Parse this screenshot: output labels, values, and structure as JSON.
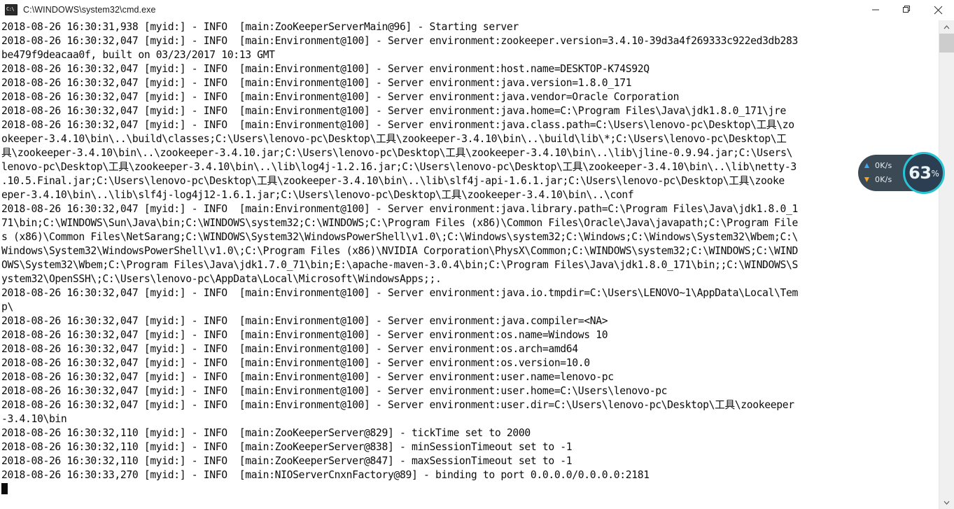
{
  "window": {
    "title": "C:\\WINDOWS\\system32\\cmd.exe",
    "icon": "cmd-icon",
    "controls": {
      "minimize": "Minimize",
      "maximize": "Maximize",
      "close": "Close"
    }
  },
  "console": {
    "prompt_cursor": "█",
    "lines": [
      "2018-08-26 16:30:31,938 [myid:] - INFO  [main:ZooKeeperServerMain@96] - Starting server",
      "2018-08-26 16:30:32,047 [myid:] - INFO  [main:Environment@100] - Server environment:zookeeper.version=3.4.10-39d3a4f269333c922ed3db283",
      "be479f9deacaa0f, built on 03/23/2017 10:13 GMT",
      "2018-08-26 16:30:32,047 [myid:] - INFO  [main:Environment@100] - Server environment:host.name=DESKTOP-K74S92Q",
      "2018-08-26 16:30:32,047 [myid:] - INFO  [main:Environment@100] - Server environment:java.version=1.8.0_171",
      "2018-08-26 16:30:32,047 [myid:] - INFO  [main:Environment@100] - Server environment:java.vendor=Oracle Corporation",
      "2018-08-26 16:30:32,047 [myid:] - INFO  [main:Environment@100] - Server environment:java.home=C:\\Program Files\\Java\\jdk1.8.0_171\\jre",
      "2018-08-26 16:30:32,047 [myid:] - INFO  [main:Environment@100] - Server environment:java.class.path=C:\\Users\\lenovo-pc\\Desktop\\工具\\zo",
      "okeeper-3.4.10\\bin\\..\\build\\classes;C:\\Users\\lenovo-pc\\Desktop\\工具\\zookeeper-3.4.10\\bin\\..\\build\\lib\\*;C:\\Users\\lenovo-pc\\Desktop\\工",
      "具\\zookeeper-3.4.10\\bin\\..\\zookeeper-3.4.10.jar;C:\\Users\\lenovo-pc\\Desktop\\工具\\zookeeper-3.4.10\\bin\\..\\lib\\jline-0.9.94.jar;C:\\Users\\",
      "lenovo-pc\\Desktop\\工具\\zookeeper-3.4.10\\bin\\..\\lib\\log4j-1.2.16.jar;C:\\Users\\lenovo-pc\\Desktop\\工具\\zookeeper-3.4.10\\bin\\..\\lib\\netty-3",
      ".10.5.Final.jar;C:\\Users\\lenovo-pc\\Desktop\\工具\\zookeeper-3.4.10\\bin\\..\\lib\\slf4j-api-1.6.1.jar;C:\\Users\\lenovo-pc\\Desktop\\工具\\zooke",
      "eper-3.4.10\\bin\\..\\lib\\slf4j-log4j12-1.6.1.jar;C:\\Users\\lenovo-pc\\Desktop\\工具\\zookeeper-3.4.10\\bin\\..\\conf",
      "2018-08-26 16:30:32,047 [myid:] - INFO  [main:Environment@100] - Server environment:java.library.path=C:\\Program Files\\Java\\jdk1.8.0_1",
      "71\\bin;C:\\WINDOWS\\Sun\\Java\\bin;C:\\WINDOWS\\system32;C:\\WINDOWS;C:\\Program Files (x86)\\Common Files\\Oracle\\Java\\javapath;C:\\Program File",
      "s (x86)\\Common Files\\NetSarang;C:\\WINDOWS\\System32\\WindowsPowerShell\\v1.0\\;C:\\Windows\\system32;C:\\Windows;C:\\Windows\\System32\\Wbem;C:\\",
      "Windows\\System32\\WindowsPowerShell\\v1.0\\;C:\\Program Files (x86)\\NVIDIA Corporation\\PhysX\\Common;C:\\WINDOWS\\system32;C:\\WINDOWS;C:\\WIND",
      "OWS\\System32\\Wbem;C:\\Program Files\\Java\\jdk1.7.0_71\\bin;E:\\apache-maven-3.0.4\\bin;C:\\Program Files\\Java\\jdk1.8.0_171\\bin;;C:\\WINDOWS\\S",
      "ystem32\\OpenSSH\\;C:\\Users\\lenovo-pc\\AppData\\Local\\Microsoft\\WindowsApps;;.",
      "2018-08-26 16:30:32,047 [myid:] - INFO  [main:Environment@100] - Server environment:java.io.tmpdir=C:\\Users\\LENOVO~1\\AppData\\Local\\Tem",
      "p\\",
      "2018-08-26 16:30:32,047 [myid:] - INFO  [main:Environment@100] - Server environment:java.compiler=<NA>",
      "2018-08-26 16:30:32,047 [myid:] - INFO  [main:Environment@100] - Server environment:os.name=Windows 10",
      "2018-08-26 16:30:32,047 [myid:] - INFO  [main:Environment@100] - Server environment:os.arch=amd64",
      "2018-08-26 16:30:32,047 [myid:] - INFO  [main:Environment@100] - Server environment:os.version=10.0",
      "2018-08-26 16:30:32,047 [myid:] - INFO  [main:Environment@100] - Server environment:user.name=lenovo-pc",
      "2018-08-26 16:30:32,047 [myid:] - INFO  [main:Environment@100] - Server environment:user.home=C:\\Users\\lenovo-pc",
      "2018-08-26 16:30:32,047 [myid:] - INFO  [main:Environment@100] - Server environment:user.dir=C:\\Users\\lenovo-pc\\Desktop\\工具\\zookeeper",
      "-3.4.10\\bin",
      "2018-08-26 16:30:32,110 [myid:] - INFO  [main:ZooKeeperServer@829] - tickTime set to 2000",
      "2018-08-26 16:30:32,110 [myid:] - INFO  [main:ZooKeeperServer@838] - minSessionTimeout set to -1",
      "2018-08-26 16:30:32,110 [myid:] - INFO  [main:ZooKeeperServer@847] - maxSessionTimeout set to -1",
      "2018-08-26 16:30:33,270 [myid:] - INFO  [main:NIOServerCnxnFactory@89] - binding to port 0.0.0.0/0.0.0.0:2181"
    ]
  },
  "net_widget": {
    "upload_speed": "0K/s",
    "download_speed": "0K/s",
    "percent": "63",
    "percent_sign": "%",
    "ring_color": "#28c3d4",
    "pill_color": "#20303e",
    "upload_arrow": "▲",
    "download_arrow": "▼"
  },
  "scrollbar": {
    "up_arrow": "⌃",
    "down_arrow": "⌄"
  }
}
